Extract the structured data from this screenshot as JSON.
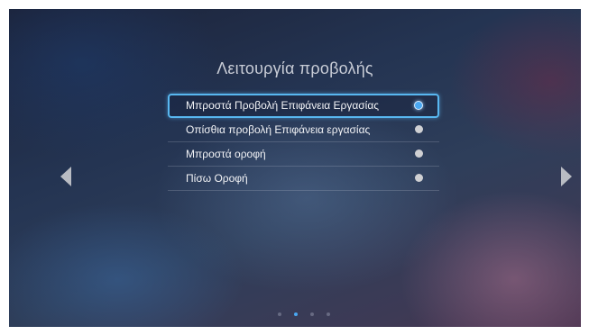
{
  "screen": {
    "title": "Λειτουργία προβολής"
  },
  "menu": {
    "items": [
      {
        "label": "Μπροστά Προβολή Επιφάνεια Εργασίας",
        "selected": true
      },
      {
        "label": "Οπίσθια προβολή Επιφάνεια εργασίας",
        "selected": false
      },
      {
        "label": "Μπροστά οροφή",
        "selected": false
      },
      {
        "label": "Πίσω Οροφή",
        "selected": false
      }
    ]
  },
  "navigation": {
    "left_icon": "triangle-left-icon",
    "right_icon": "triangle-right-icon"
  },
  "pager": {
    "page_count": 4,
    "current_page": 2
  },
  "colors": {
    "accent": "#4aa8f2",
    "radio_inactive": "#cfd0d3",
    "text": "#f2f3f6"
  }
}
